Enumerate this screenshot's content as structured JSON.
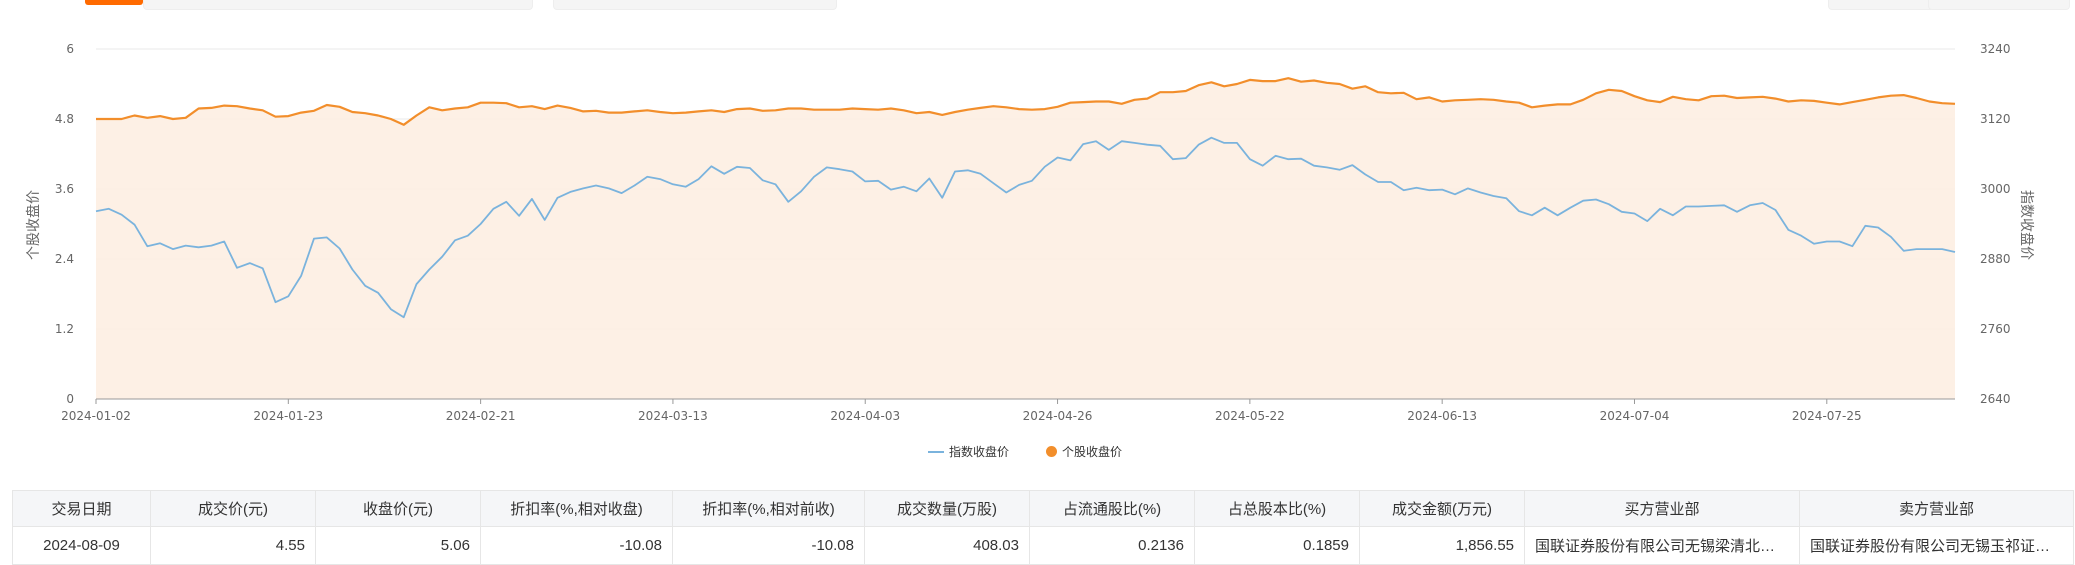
{
  "chart_data": {
    "type": "line",
    "left_axis": {
      "label": "个股收盘价",
      "ticks": [
        "0",
        "1.2",
        "2.4",
        "3.6",
        "4.8",
        "6"
      ],
      "range": [
        0,
        6
      ]
    },
    "right_axis": {
      "label": "指数收盘价",
      "ticks": [
        "2640",
        "2760",
        "2880",
        "3000",
        "3120",
        "3240"
      ],
      "range": [
        2640,
        3240
      ]
    },
    "x_ticks": [
      "2024-01-02",
      "2024-01-23",
      "2024-02-21",
      "2024-03-13",
      "2024-04-03",
      "2024-04-26",
      "2024-05-22",
      "2024-06-13",
      "2024-07-04",
      "2024-07-25"
    ],
    "x_tick_index": [
      0,
      15,
      30,
      45,
      60,
      75,
      90,
      105,
      120,
      135
    ],
    "series": [
      {
        "name": "指数收盘价",
        "axis": "right",
        "color": "#7ab3dd",
        "values": [
          2962,
          2966,
          2956,
          2939,
          2902,
          2907,
          2897,
          2903,
          2900,
          2903,
          2910,
          2865,
          2873,
          2864,
          2806,
          2816,
          2851,
          2915,
          2917,
          2898,
          2862,
          2834,
          2822,
          2794,
          2780,
          2837,
          2862,
          2884,
          2912,
          2920,
          2940,
          2966,
          2978,
          2954,
          2983,
          2947,
          2985,
          2995,
          3001,
          3006,
          3001,
          2993,
          3006,
          3021,
          3017,
          3008,
          3004,
          3017,
          3039,
          3026,
          3038,
          3036,
          3015,
          3008,
          2978,
          2996,
          3021,
          3037,
          3034,
          3030,
          3013,
          3014,
          2999,
          3004,
          2996,
          3018,
          2985,
          3030,
          3032,
          3026,
          3010,
          2994,
          3007,
          3014,
          3038,
          3054,
          3049,
          3077,
          3082,
          3067,
          3082,
          3079,
          3076,
          3074,
          3051,
          3053,
          3076,
          3088,
          3079,
          3079,
          3051,
          3040,
          3057,
          3051,
          3052,
          3040,
          3037,
          3033,
          3041,
          3025,
          3012,
          3012,
          2998,
          3002,
          2998,
          2999,
          2991,
          3001,
          2994,
          2988,
          2984,
          2962,
          2955,
          2968,
          2955,
          2968,
          2980,
          2982,
          2974,
          2961,
          2958,
          2945,
          2966,
          2955,
          2970,
          2970,
          2971,
          2972,
          2961,
          2972,
          2976,
          2964,
          2930,
          2920,
          2906,
          2910,
          2910,
          2902,
          2937,
          2934,
          2918,
          2894,
          2897,
          2897,
          2897,
          2892
        ]
      },
      {
        "name": "个股收盘价",
        "axis": "left",
        "color": "#f28e2b",
        "values": [
          4.8,
          4.8,
          4.8,
          4.86,
          4.82,
          4.85,
          4.8,
          4.82,
          4.98,
          4.99,
          5.03,
          5.02,
          4.98,
          4.95,
          4.84,
          4.85,
          4.91,
          4.94,
          5.04,
          5.01,
          4.92,
          4.9,
          4.86,
          4.8,
          4.7,
          4.86,
          5.0,
          4.95,
          4.98,
          5.0,
          5.08,
          5.08,
          5.07,
          5.0,
          5.02,
          4.97,
          5.03,
          4.99,
          4.93,
          4.94,
          4.91,
          4.91,
          4.93,
          4.95,
          4.92,
          4.9,
          4.91,
          4.93,
          4.95,
          4.92,
          4.97,
          4.98,
          4.94,
          4.95,
          4.98,
          4.98,
          4.96,
          4.96,
          4.96,
          4.98,
          4.97,
          4.96,
          4.98,
          4.95,
          4.9,
          4.92,
          4.87,
          4.92,
          4.96,
          4.99,
          5.02,
          5.0,
          4.97,
          4.96,
          4.97,
          5.01,
          5.08,
          5.09,
          5.1,
          5.1,
          5.06,
          5.13,
          5.15,
          5.26,
          5.26,
          5.28,
          5.38,
          5.43,
          5.36,
          5.4,
          5.47,
          5.45,
          5.45,
          5.5,
          5.44,
          5.46,
          5.42,
          5.4,
          5.32,
          5.36,
          5.26,
          5.24,
          5.25,
          5.14,
          5.17,
          5.1,
          5.12,
          5.13,
          5.14,
          5.13,
          5.1,
          5.08,
          5.0,
          5.03,
          5.05,
          5.05,
          5.13,
          5.24,
          5.3,
          5.28,
          5.19,
          5.12,
          5.09,
          5.18,
          5.14,
          5.12,
          5.19,
          5.2,
          5.16,
          5.17,
          5.18,
          5.15,
          5.1,
          5.12,
          5.11,
          5.08,
          5.05,
          5.09,
          5.13,
          5.17,
          5.2,
          5.21,
          5.16,
          5.1,
          5.07,
          5.06
        ]
      }
    ]
  },
  "table": {
    "headers": [
      "交易日期",
      "成交价(元)",
      "收盘价(元)",
      "折扣率(%,相对收盘)",
      "折扣率(%,相对前收)",
      "成交数量(万股)",
      "占流通股比(%)",
      "占总股本比(%)",
      "成交金额(万元)",
      "买方营业部",
      "卖方营业部"
    ],
    "rows": [
      [
        "2024-08-09",
        "4.55",
        "5.06",
        "-10.08",
        "-10.08",
        "408.03",
        "0.2136",
        "0.1859",
        "1,856.55",
        "国联证券股份有限公司无锡梁清北路证券营业部",
        "国联证券股份有限公司无锡玉祁证券营业部"
      ]
    ]
  }
}
